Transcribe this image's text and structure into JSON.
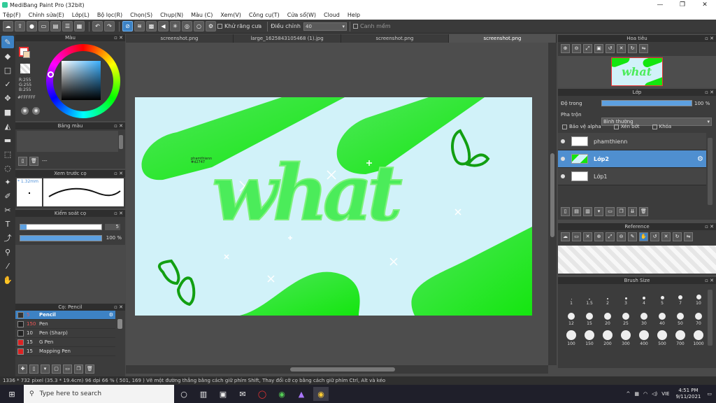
{
  "window": {
    "title": "MediBang Paint Pro (32bit)",
    "minimize": "—",
    "restore": "❐",
    "close": "✕"
  },
  "menu": [
    "Tệp(F)",
    "Chỉnh sửa(E)",
    "Lớp(L)",
    "Bộ lọc(R)",
    "Chọn(S)",
    "Chụp(N)",
    "Màu (C)",
    "Xem(V)",
    "Công cụ(T)",
    "Cửa sổ(W)",
    "Cloud",
    "Help"
  ],
  "toolbar": {
    "antialias": "Khử răng cưa",
    "adjust_label": "Điều chỉnh",
    "adjust_value": "40",
    "smooth": "Canh mềm"
  },
  "color_panel": {
    "title": "Màu",
    "r": "R:255",
    "g": "G:255",
    "b": "B:255",
    "hex": "#FFFFFF"
  },
  "palette_panel": {
    "title": "Bảng màu",
    "hint": "---"
  },
  "preview_panel": {
    "title": "Xem trước cọ",
    "size": "* 1.32mm"
  },
  "control_panel": {
    "title": "Kiểm soát cọ",
    "size_value": "5",
    "opacity_value": "100 %"
  },
  "brush_panel": {
    "title": "Cọ: Pencil",
    "items": [
      {
        "size": "5",
        "name": "Pencil",
        "color": "#333333",
        "selected": true
      },
      {
        "size": "150",
        "name": "Pen",
        "color": "#222222",
        "selected": false
      },
      {
        "size": "10",
        "name": "Pen (Sharp)",
        "color": "#222222",
        "selected": false
      },
      {
        "size": "15",
        "name": "G Pen",
        "color": "#dd2222",
        "selected": false
      },
      {
        "size": "15",
        "name": "Mapping Pen",
        "color": "#dd2222",
        "selected": false
      }
    ]
  },
  "tabs": [
    "screenshot.png",
    "large_1625843105468 (1).jpg",
    "screenshot.png",
    "screenshot.png"
  ],
  "canvas": {
    "word": "what",
    "tag_line1": "phamthienn",
    "tag_line2": "#d2747",
    "bg": "#d1f2f9",
    "green": "#14e60f"
  },
  "navigator": {
    "title": "Hoa tiêu"
  },
  "layer_panel": {
    "title": "Lớp",
    "opacity_label": "Độ trong",
    "opacity_value": "100 %",
    "blend_label": "Pha trộn",
    "blend_value": "Bình thường",
    "protect_alpha": "Bảo vệ alpha",
    "clipping": "Xén bớt",
    "lock": "Khóa",
    "layers": [
      {
        "name": "phamthienn",
        "selected": false
      },
      {
        "name": "Lớp2",
        "selected": true
      },
      {
        "name": "Lớp1",
        "selected": false
      }
    ]
  },
  "reference_panel": {
    "title": "Reference"
  },
  "brushsize_panel": {
    "title": "Brush Size",
    "sizes": [
      "1",
      "1.5",
      "2",
      "3",
      "4",
      "5",
      "7",
      "10",
      "12",
      "15",
      "20",
      "25",
      "30",
      "40",
      "50",
      "70",
      "100",
      "150",
      "200",
      "300",
      "400",
      "500",
      "700",
      "1000"
    ]
  },
  "status": "1336 * 732 pixel  (35.3 * 19.4cm)  96 dpi  66 %  ( 501, 169 )  Vẽ một đường thẳng bằng cách giữ phím Shift, Thay đổi cỡ cọ bằng cách giữ phím Ctrl, Alt và kéo",
  "taskbar": {
    "search": "Type here to search",
    "lang": "VIE",
    "time": "4:51 PM",
    "date": "9/11/2021"
  }
}
